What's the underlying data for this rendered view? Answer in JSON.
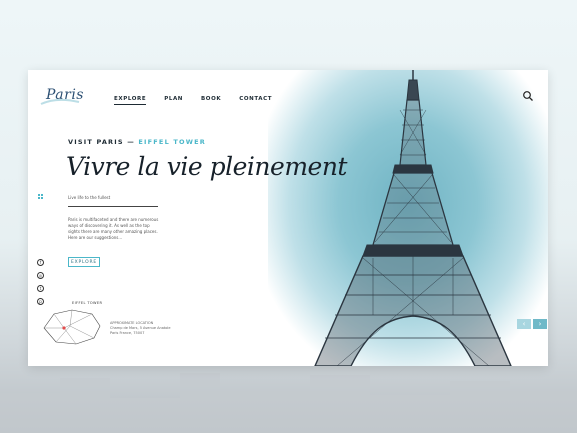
{
  "logo": {
    "text": "Paris"
  },
  "nav": {
    "items": [
      "EXPLORE",
      "PLAN",
      "BOOK",
      "CONTACT"
    ],
    "active": "EXPLORE"
  },
  "hero": {
    "kicker_prefix": "VISIT PARIS  —",
    "kicker_accent": "EIFFEL TOWER",
    "headline": "Vivre la vie pleinement",
    "tagline": "Live life to the fullest",
    "paragraph": "Paris is multifaceted and there are numerous ways of discovering it. As well as the top sights there are many other amazing places. Here are our suggestions...",
    "explore_button": "EXPLORE"
  },
  "social": {
    "items": [
      "f",
      "◎",
      "t",
      "p"
    ],
    "icons": [
      "facebook-icon",
      "instagram-icon",
      "twitter-icon",
      "pinterest-icon"
    ]
  },
  "map": {
    "label": "EIFFEL TOWER",
    "address": "APPROXIMATE LOCATION\nChamp de Mars, 5 Avenue Anatole\nParis France, 75007"
  },
  "arrows": {
    "prev": "‹",
    "next": "›"
  },
  "colors": {
    "accent": "#4bb7c9",
    "dark": "#17212a"
  }
}
